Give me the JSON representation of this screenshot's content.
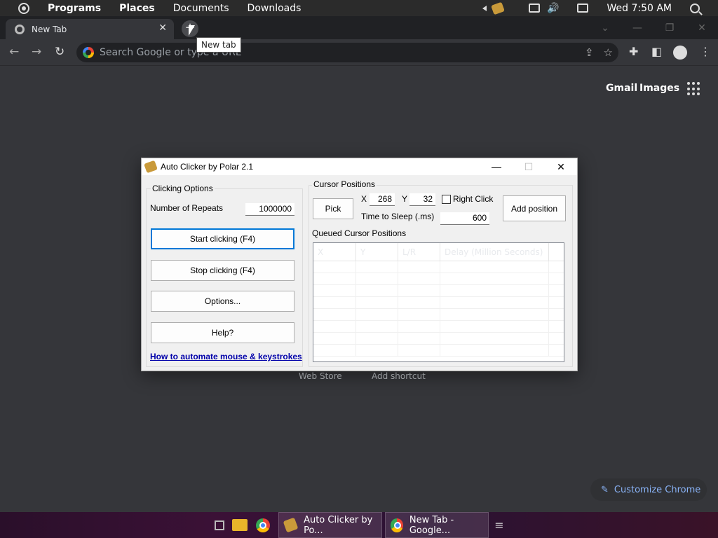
{
  "topbar": {
    "programs": "Programs",
    "places": "Places",
    "documents": "Documents",
    "downloads": "Downloads",
    "clock": "Wed 7:50 AM"
  },
  "browser": {
    "tab_title": "New Tab",
    "new_tab_tooltip": "New tab",
    "omnibox_placeholder": "Search Google or type a URL",
    "ntp": {
      "gmail": "Gmail",
      "images": "Images",
      "shortcut_web_store": "Web Store",
      "shortcut_add": "Add shortcut",
      "customize": "Customize Chrome"
    }
  },
  "autoclicker": {
    "title": "Auto Clicker by Polar 2.1",
    "clicking_options_label": "Clicking Options",
    "repeats_label": "Number of Repeats",
    "repeats_value": "1000000",
    "start_button": "Start clicking (F4)",
    "stop_button": "Stop clicking (F4)",
    "options_button": "Options...",
    "help_button": "Help?",
    "link_text": "How to automate mouse & keystrokes",
    "cursor_positions_label": "Cursor Positions",
    "pick_button": "Pick",
    "x_label": "X",
    "x_value": "268",
    "y_label": "Y",
    "y_value": "32",
    "right_click_label": "Right Click",
    "sleep_label": "Time to Sleep (.ms)",
    "sleep_value": "600",
    "add_position_button": "Add position",
    "queued_label": "Queued Cursor Positions",
    "columns": [
      "X",
      "Y",
      "L/R",
      "Delay (Million Seconds)"
    ]
  },
  "taskbar": {
    "autoclicker_item": "Auto Clicker by Po...",
    "chrome_item": "New Tab - Google..."
  }
}
